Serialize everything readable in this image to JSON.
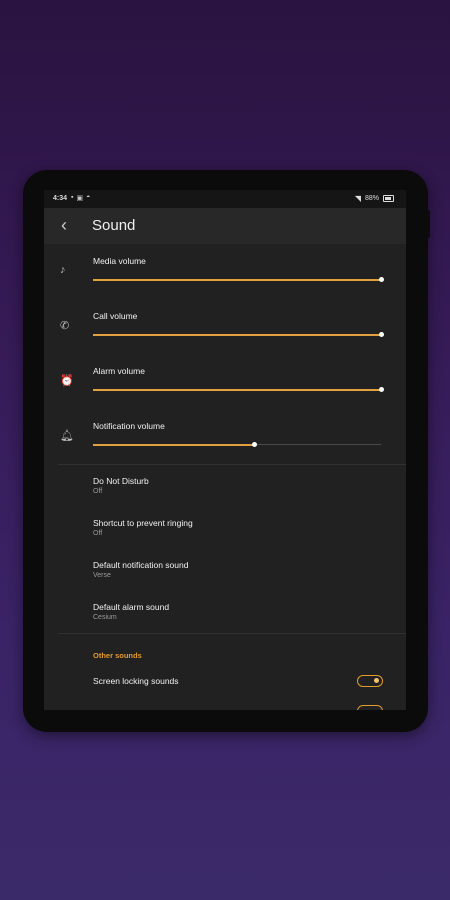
{
  "status_bar": {
    "time": "4:34",
    "left_icons": [
      "notification-icon",
      "photo-icon",
      "android-icon"
    ],
    "battery": "88%"
  },
  "app_bar": {
    "title": "Sound"
  },
  "volumes": [
    {
      "label": "Media volume",
      "icon": "music-note-icon",
      "level": 1.0
    },
    {
      "label": "Call volume",
      "icon": "phone-icon",
      "level": 1.0
    },
    {
      "label": "Alarm volume",
      "icon": "alarm-clock-icon",
      "level": 1.0
    },
    {
      "label": "Notification volume",
      "icon": "bell-icon",
      "level": 0.56
    }
  ],
  "settings": [
    {
      "title": "Do Not Disturb",
      "value": "Off"
    },
    {
      "title": "Shortcut to prevent ringing",
      "value": "Off"
    },
    {
      "title": "Default notification sound",
      "value": "Verse"
    },
    {
      "title": "Default alarm sound",
      "value": "Cesium"
    }
  ],
  "other_sounds": {
    "header": "Other sounds",
    "items": [
      {
        "label": "Screen locking sounds",
        "on": true
      }
    ]
  },
  "colors": {
    "accent": "#e39b2b",
    "screen_background": "#212121",
    "page_background_top": "#2a1340",
    "page_background_bottom": "#3b2a6a"
  }
}
